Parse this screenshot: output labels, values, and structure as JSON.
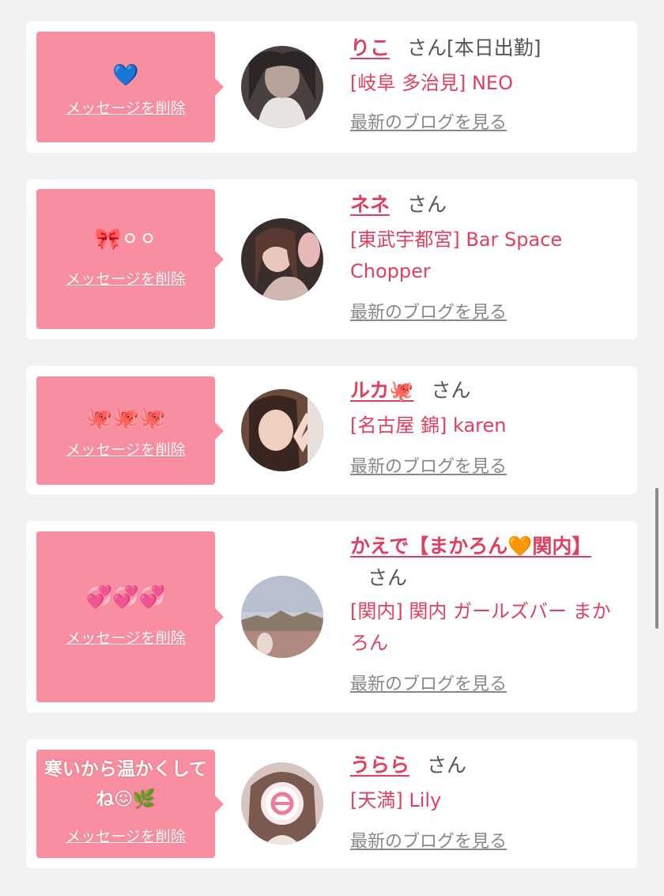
{
  "cards": [
    {
      "message": "💙",
      "delete_label": "メッセージを削除",
      "name": "りこ",
      "honorific": "さん[本日出勤]",
      "shop": "[岐阜 多治見] NEO",
      "blog_label": "最新のブログを見る"
    },
    {
      "message": "🎀⚪⚪",
      "delete_label": "メッセージを削除",
      "name": "ネネ",
      "honorific": "さん",
      "shop": "[東武宇都宮] Bar Space Chopper",
      "blog_label": "最新のブログを見る"
    },
    {
      "message": "🐙🐙🐙",
      "delete_label": "メッセージを削除",
      "name": "ルカ🐙",
      "honorific": "さん",
      "shop": "[名古屋 錦] karen",
      "blog_label": "最新のブログを見る"
    },
    {
      "message": "💞💞💞",
      "delete_label": "メッセージを削除",
      "name": "かえで【まかろん🧡関内】",
      "honorific": "さん",
      "shop": "[関内] 関内 ガールズバー まかろん",
      "blog_label": "最新のブログを見る"
    },
    {
      "message": "寒いから温かくしてね😖🌿",
      "delete_label": "メッセージを削除",
      "name": "うらら",
      "honorific": "さん",
      "shop": "[天満] Lily",
      "blog_label": "最新のブログを見る"
    }
  ],
  "colors": {
    "bubble": "#f98ea0",
    "name": "#e0405f",
    "link_gray": "#888888",
    "background": "#f2f2f2"
  }
}
